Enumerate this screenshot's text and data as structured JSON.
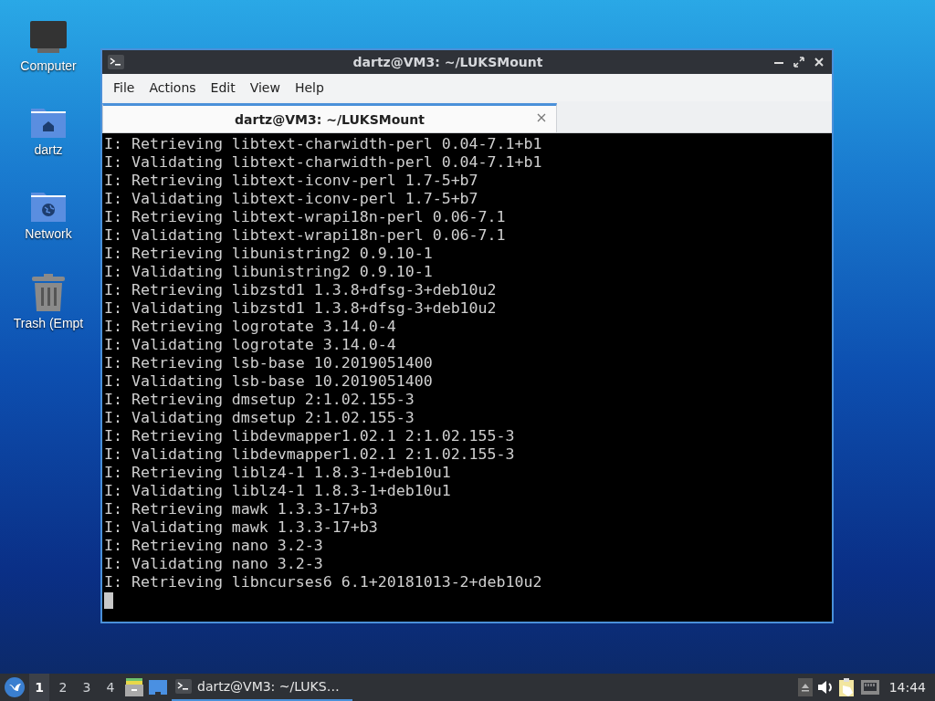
{
  "desktop_icons": [
    {
      "kind": "computer",
      "label": "Computer"
    },
    {
      "kind": "home",
      "label": "dartz"
    },
    {
      "kind": "network",
      "label": "Network"
    },
    {
      "kind": "trash",
      "label": "Trash (Empt"
    }
  ],
  "window": {
    "title": "dartz@VM3: ~/LUKSMount",
    "menu": [
      "File",
      "Actions",
      "Edit",
      "View",
      "Help"
    ],
    "tabs": [
      {
        "label": "dartz@VM3: ~/LUKSMount",
        "selected": true
      }
    ],
    "terminal_lines": [
      "I: Retrieving libtext-charwidth-perl 0.04-7.1+b1",
      "I: Validating libtext-charwidth-perl 0.04-7.1+b1",
      "I: Retrieving libtext-iconv-perl 1.7-5+b7",
      "I: Validating libtext-iconv-perl 1.7-5+b7",
      "I: Retrieving libtext-wrapi18n-perl 0.06-7.1",
      "I: Validating libtext-wrapi18n-perl 0.06-7.1",
      "I: Retrieving libunistring2 0.9.10-1",
      "I: Validating libunistring2 0.9.10-1",
      "I: Retrieving libzstd1 1.3.8+dfsg-3+deb10u2",
      "I: Validating libzstd1 1.3.8+dfsg-3+deb10u2",
      "I: Retrieving logrotate 3.14.0-4",
      "I: Validating logrotate 3.14.0-4",
      "I: Retrieving lsb-base 10.2019051400",
      "I: Validating lsb-base 10.2019051400",
      "I: Retrieving dmsetup 2:1.02.155-3",
      "I: Validating dmsetup 2:1.02.155-3",
      "I: Retrieving libdevmapper1.02.1 2:1.02.155-3",
      "I: Validating libdevmapper1.02.1 2:1.02.155-3",
      "I: Retrieving liblz4-1 1.8.3-1+deb10u1",
      "I: Validating liblz4-1 1.8.3-1+deb10u1",
      "I: Retrieving mawk 1.3.3-17+b3",
      "I: Validating mawk 1.3.3-17+b3",
      "I: Retrieving nano 3.2-3",
      "I: Validating nano 3.2-3",
      "I: Retrieving libncurses6 6.1+20181013-2+deb10u2"
    ]
  },
  "taskbar": {
    "workspaces": [
      {
        "label": "1",
        "selected": true
      },
      {
        "label": "2",
        "selected": false
      },
      {
        "label": "3",
        "selected": false
      },
      {
        "label": "4",
        "selected": false
      }
    ],
    "tasks": [
      {
        "label": "dartz@VM3: ~/LUKS…",
        "selected": true
      }
    ],
    "clock": "14:44"
  }
}
